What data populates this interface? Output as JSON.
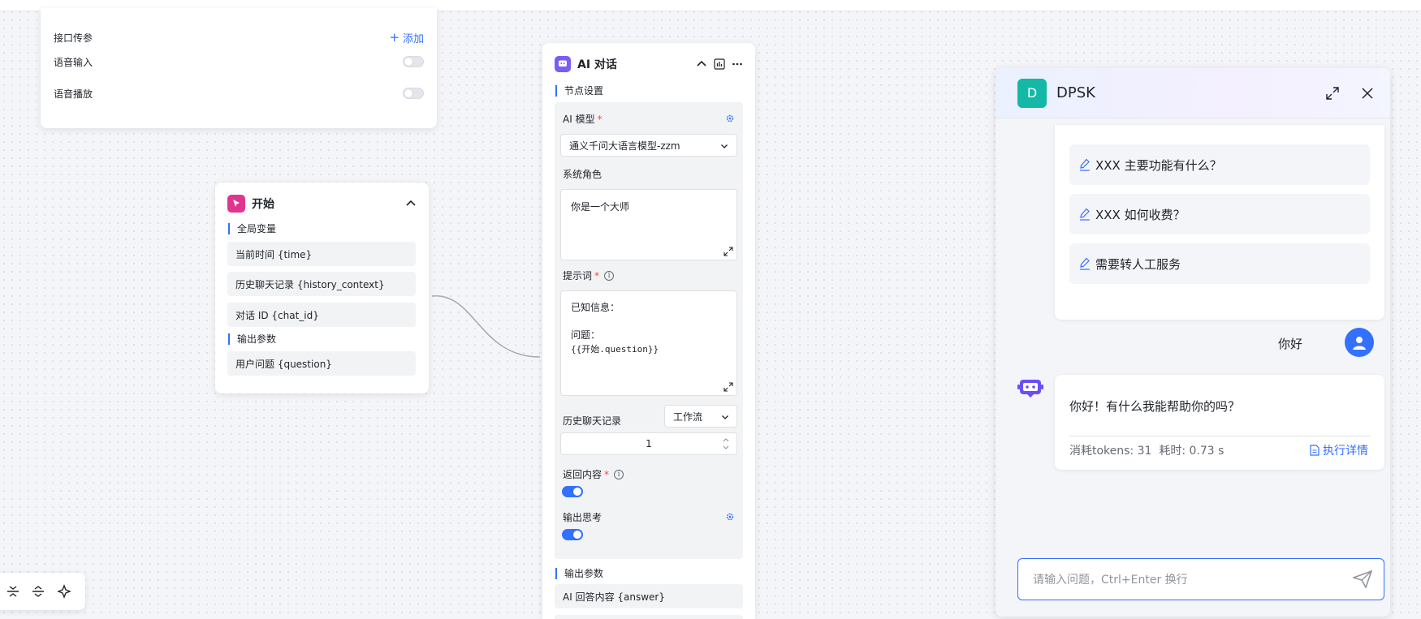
{
  "settings": {
    "api_params_label": "接口传参",
    "add_label": "添加",
    "voice_input_label": "语音输入",
    "voice_play_label": "语音播放"
  },
  "start_node": {
    "title": "开始",
    "global_vars_label": "全局变量",
    "global_vars": [
      "当前时间 {time}",
      "历史聊天记录 {history_context}",
      "对话 ID {chat_id}"
    ],
    "output_label": "输出参数",
    "outputs": [
      "用户问题 {question}"
    ]
  },
  "ai_node": {
    "title": "AI 对话",
    "node_settings_label": "节点设置",
    "model_label": "AI 模型",
    "model_value": "通义千问大语言模型-zzm",
    "system_role_label": "系统角色",
    "system_role_value": "你是一个大师",
    "prompt_label": "提示词",
    "prompt_line1": "已知信息：",
    "prompt_line2": "问题：",
    "prompt_line3": "{{开始.question}}",
    "history_label": "历史聊天记录",
    "history_source": "工作流",
    "history_count": "1",
    "return_label": "返回内容",
    "think_label": "输出思考",
    "output_label": "输出参数",
    "output_field": "AI 回答内容 {answer}"
  },
  "chat": {
    "avatar_letter": "D",
    "title": "DPSK",
    "suggestions": [
      "XXX 主要功能有什么？",
      "XXX 如何收费？",
      "需要转人工服务"
    ],
    "user_message": "你好",
    "bot_message": "你好！有什么我能帮助你的吗？",
    "tokens_text": "消耗tokens: 31",
    "time_text": "耗时: 0.73 s",
    "detail_label": "执行详情",
    "input_placeholder": "请输入问题，Ctrl+Enter 换行"
  },
  "colors": {
    "accent": "#3370ff",
    "avatar_bg": "#14b8a6",
    "ai_icon_bg": "#7c5cf8",
    "start_icon_bg": "#e0358d"
  }
}
